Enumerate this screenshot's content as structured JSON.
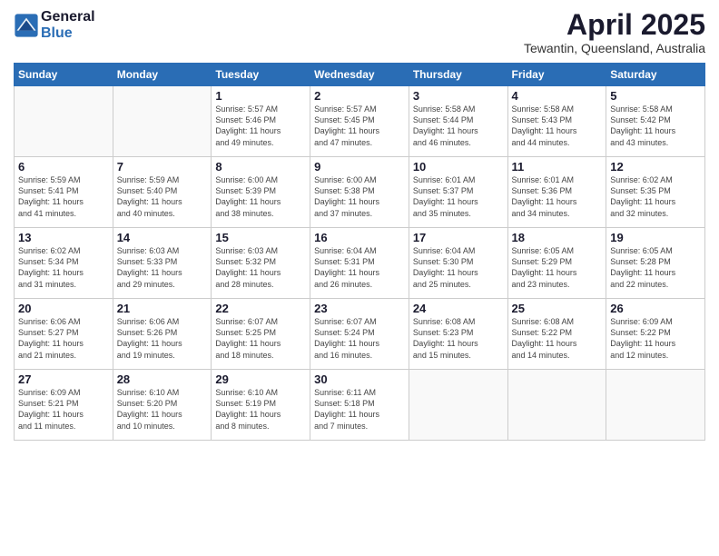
{
  "header": {
    "logo_line1": "General",
    "logo_line2": "Blue",
    "month_title": "April 2025",
    "location": "Tewantin, Queensland, Australia"
  },
  "weekdays": [
    "Sunday",
    "Monday",
    "Tuesday",
    "Wednesday",
    "Thursday",
    "Friday",
    "Saturday"
  ],
  "weeks": [
    [
      {
        "day": "",
        "detail": ""
      },
      {
        "day": "",
        "detail": ""
      },
      {
        "day": "1",
        "detail": "Sunrise: 5:57 AM\nSunset: 5:46 PM\nDaylight: 11 hours\nand 49 minutes."
      },
      {
        "day": "2",
        "detail": "Sunrise: 5:57 AM\nSunset: 5:45 PM\nDaylight: 11 hours\nand 47 minutes."
      },
      {
        "day": "3",
        "detail": "Sunrise: 5:58 AM\nSunset: 5:44 PM\nDaylight: 11 hours\nand 46 minutes."
      },
      {
        "day": "4",
        "detail": "Sunrise: 5:58 AM\nSunset: 5:43 PM\nDaylight: 11 hours\nand 44 minutes."
      },
      {
        "day": "5",
        "detail": "Sunrise: 5:58 AM\nSunset: 5:42 PM\nDaylight: 11 hours\nand 43 minutes."
      }
    ],
    [
      {
        "day": "6",
        "detail": "Sunrise: 5:59 AM\nSunset: 5:41 PM\nDaylight: 11 hours\nand 41 minutes."
      },
      {
        "day": "7",
        "detail": "Sunrise: 5:59 AM\nSunset: 5:40 PM\nDaylight: 11 hours\nand 40 minutes."
      },
      {
        "day": "8",
        "detail": "Sunrise: 6:00 AM\nSunset: 5:39 PM\nDaylight: 11 hours\nand 38 minutes."
      },
      {
        "day": "9",
        "detail": "Sunrise: 6:00 AM\nSunset: 5:38 PM\nDaylight: 11 hours\nand 37 minutes."
      },
      {
        "day": "10",
        "detail": "Sunrise: 6:01 AM\nSunset: 5:37 PM\nDaylight: 11 hours\nand 35 minutes."
      },
      {
        "day": "11",
        "detail": "Sunrise: 6:01 AM\nSunset: 5:36 PM\nDaylight: 11 hours\nand 34 minutes."
      },
      {
        "day": "12",
        "detail": "Sunrise: 6:02 AM\nSunset: 5:35 PM\nDaylight: 11 hours\nand 32 minutes."
      }
    ],
    [
      {
        "day": "13",
        "detail": "Sunrise: 6:02 AM\nSunset: 5:34 PM\nDaylight: 11 hours\nand 31 minutes."
      },
      {
        "day": "14",
        "detail": "Sunrise: 6:03 AM\nSunset: 5:33 PM\nDaylight: 11 hours\nand 29 minutes."
      },
      {
        "day": "15",
        "detail": "Sunrise: 6:03 AM\nSunset: 5:32 PM\nDaylight: 11 hours\nand 28 minutes."
      },
      {
        "day": "16",
        "detail": "Sunrise: 6:04 AM\nSunset: 5:31 PM\nDaylight: 11 hours\nand 26 minutes."
      },
      {
        "day": "17",
        "detail": "Sunrise: 6:04 AM\nSunset: 5:30 PM\nDaylight: 11 hours\nand 25 minutes."
      },
      {
        "day": "18",
        "detail": "Sunrise: 6:05 AM\nSunset: 5:29 PM\nDaylight: 11 hours\nand 23 minutes."
      },
      {
        "day": "19",
        "detail": "Sunrise: 6:05 AM\nSunset: 5:28 PM\nDaylight: 11 hours\nand 22 minutes."
      }
    ],
    [
      {
        "day": "20",
        "detail": "Sunrise: 6:06 AM\nSunset: 5:27 PM\nDaylight: 11 hours\nand 21 minutes."
      },
      {
        "day": "21",
        "detail": "Sunrise: 6:06 AM\nSunset: 5:26 PM\nDaylight: 11 hours\nand 19 minutes."
      },
      {
        "day": "22",
        "detail": "Sunrise: 6:07 AM\nSunset: 5:25 PM\nDaylight: 11 hours\nand 18 minutes."
      },
      {
        "day": "23",
        "detail": "Sunrise: 6:07 AM\nSunset: 5:24 PM\nDaylight: 11 hours\nand 16 minutes."
      },
      {
        "day": "24",
        "detail": "Sunrise: 6:08 AM\nSunset: 5:23 PM\nDaylight: 11 hours\nand 15 minutes."
      },
      {
        "day": "25",
        "detail": "Sunrise: 6:08 AM\nSunset: 5:22 PM\nDaylight: 11 hours\nand 14 minutes."
      },
      {
        "day": "26",
        "detail": "Sunrise: 6:09 AM\nSunset: 5:22 PM\nDaylight: 11 hours\nand 12 minutes."
      }
    ],
    [
      {
        "day": "27",
        "detail": "Sunrise: 6:09 AM\nSunset: 5:21 PM\nDaylight: 11 hours\nand 11 minutes."
      },
      {
        "day": "28",
        "detail": "Sunrise: 6:10 AM\nSunset: 5:20 PM\nDaylight: 11 hours\nand 10 minutes."
      },
      {
        "day": "29",
        "detail": "Sunrise: 6:10 AM\nSunset: 5:19 PM\nDaylight: 11 hours\nand 8 minutes."
      },
      {
        "day": "30",
        "detail": "Sunrise: 6:11 AM\nSunset: 5:18 PM\nDaylight: 11 hours\nand 7 minutes."
      },
      {
        "day": "",
        "detail": ""
      },
      {
        "day": "",
        "detail": ""
      },
      {
        "day": "",
        "detail": ""
      }
    ]
  ]
}
